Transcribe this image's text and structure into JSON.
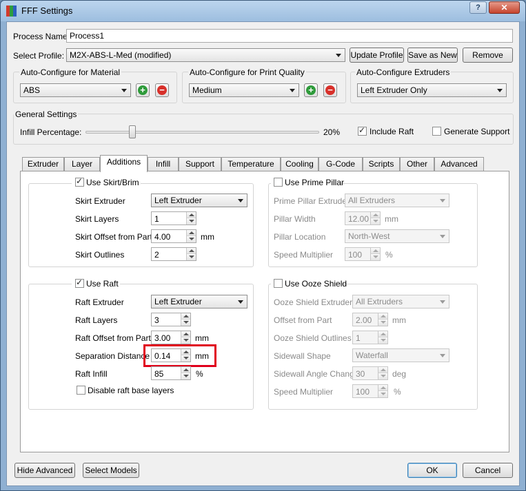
{
  "window": {
    "title": "FFF Settings",
    "help_label": "?",
    "close_label": "✕"
  },
  "process_name": {
    "label": "Process Name:",
    "value": "Process1"
  },
  "profile": {
    "label": "Select Profile:",
    "value": "M2X-ABS-L-Med (modified)",
    "update_label": "Update Profile",
    "saveas_label": "Save as New",
    "remove_label": "Remove"
  },
  "auto_material": {
    "title": "Auto-Configure for Material",
    "value": "ABS"
  },
  "auto_quality": {
    "title": "Auto-Configure for Print Quality",
    "value": "Medium"
  },
  "auto_extruders": {
    "title": "Auto-Configure Extruders",
    "value": "Left Extruder Only"
  },
  "general": {
    "title": "General Settings",
    "infill_label": "Infill Percentage:",
    "infill_value": "20%",
    "infill_fraction": 0.2,
    "include_raft_label": "Include Raft",
    "include_raft_checked": true,
    "generate_support_label": "Generate Support",
    "generate_support_checked": false
  },
  "tabs": [
    "Extruder",
    "Layer",
    "Additions",
    "Infill",
    "Support",
    "Temperature",
    "Cooling",
    "G-Code",
    "Scripts",
    "Other",
    "Advanced"
  ],
  "active_tab": "Additions",
  "skirt": {
    "title": "Use Skirt/Brim",
    "checked": true,
    "extruder_label": "Skirt Extruder",
    "extruder_value": "Left Extruder",
    "layers_label": "Skirt Layers",
    "layers_value": "1",
    "offset_label": "Skirt Offset from Part",
    "offset_value": "4.00",
    "offset_unit": "mm",
    "outlines_label": "Skirt Outlines",
    "outlines_value": "2"
  },
  "prime_pillar": {
    "title": "Use Prime Pillar",
    "checked": false,
    "extruder_label": "Prime Pillar Extruder",
    "extruder_value": "All Extruders",
    "width_label": "Pillar Width",
    "width_value": "12.00",
    "width_unit": "mm",
    "location_label": "Pillar Location",
    "location_value": "North-West",
    "speed_label": "Speed Multiplier",
    "speed_value": "100",
    "speed_unit": "%"
  },
  "raft": {
    "title": "Use Raft",
    "checked": true,
    "extruder_label": "Raft Extruder",
    "extruder_value": "Left Extruder",
    "layers_label": "Raft Layers",
    "layers_value": "3",
    "offset_label": "Raft Offset from Part",
    "offset_value": "3.00",
    "offset_unit": "mm",
    "separation_label": "Separation Distance",
    "separation_value": "0.14",
    "separation_unit": "mm",
    "infill_label": "Raft Infill",
    "infill_value": "85",
    "infill_unit": "%",
    "disable_base_label": "Disable raft base layers",
    "disable_base_checked": false
  },
  "ooze": {
    "title": "Use Ooze Shield",
    "checked": false,
    "extruder_label": "Ooze Shield Extruder",
    "extruder_value": "All Extruders",
    "offset_label": "Offset from Part",
    "offset_value": "2.00",
    "offset_unit": "mm",
    "outlines_label": "Ooze Shield Outlines",
    "outlines_value": "1",
    "shape_label": "Sidewall Shape",
    "shape_value": "Waterfall",
    "angle_label": "Sidewall Angle Change",
    "angle_value": "30",
    "angle_unit": "deg",
    "speed_label": "Speed Multiplier",
    "speed_value": "100",
    "speed_unit": "%"
  },
  "footer": {
    "hide_advanced_label": "Hide Advanced",
    "select_models_label": "Select Models",
    "ok_label": "OK",
    "cancel_label": "Cancel"
  },
  "colors": {
    "accent_highlight": "#e0001b",
    "plus_green": "#2e9b3a",
    "minus_red": "#d8302a"
  }
}
